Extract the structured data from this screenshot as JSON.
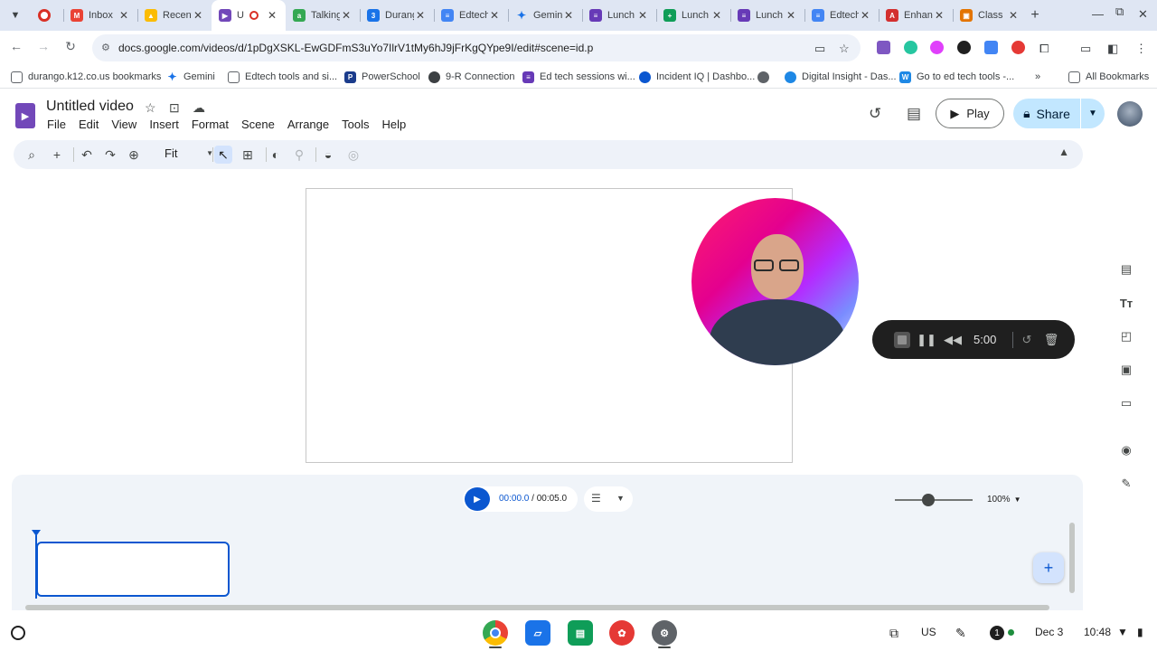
{
  "browser": {
    "tabs": [
      {
        "title": "",
        "color": "#d93025"
      },
      {
        "title": "Inbox",
        "color": "#ea4335"
      },
      {
        "title": "Recent",
        "color": "#fbbc04"
      },
      {
        "title": "U",
        "color": "#7248b9",
        "recording_indicator": true
      },
      {
        "title": "Talking",
        "color": "#34a853"
      },
      {
        "title": "Durango",
        "color": "#1a73e8"
      },
      {
        "title": "Edtech",
        "color": "#4285f4"
      },
      {
        "title": "Gemini",
        "color": "#1a73e8"
      },
      {
        "title": "Lunch",
        "color": "#673ab7"
      },
      {
        "title": "Lunch",
        "color": "#0f9d58"
      },
      {
        "title": "Lunch",
        "color": "#673ab7"
      },
      {
        "title": "Edtech",
        "color": "#4285f4"
      },
      {
        "title": "Enhance",
        "color": "#d32f2f"
      },
      {
        "title": "Class",
        "color": "#e37400"
      }
    ],
    "url": "docs.google.com/videos/d/1pDgXSKL-EwGDFmS3uYo7IlrV1tMy6hJ9jFrKgQYpe9I/edit#scene=id.p",
    "bookmarks": [
      {
        "label": "durango.k12.co.us bookmarks",
        "icon": "folder-icon"
      },
      {
        "label": "Gemini",
        "icon": "gemini-icon"
      },
      {
        "label": "Edtech tools and si...",
        "icon": "folder-icon"
      },
      {
        "label": "PowerSchool",
        "icon": "powerschool-icon"
      },
      {
        "label": "9-R Connection",
        "icon": "connection-icon"
      },
      {
        "label": "Ed tech sessions wi...",
        "icon": "forms-icon"
      },
      {
        "label": "Incident IQ | Dashbo...",
        "icon": "incidentiq-icon"
      },
      {
        "label": "",
        "icon": "globe-icon"
      },
      {
        "label": "Digital Insight - Das...",
        "icon": "insight-icon"
      },
      {
        "label": "Go to ed tech tools -...",
        "icon": "w-icon"
      }
    ],
    "all_bookmarks": "All Bookmarks",
    "more_bookmarks": "»"
  },
  "app": {
    "title": "Untitled video",
    "menu": [
      "File",
      "Edit",
      "View",
      "Insert",
      "Format",
      "Scene",
      "Arrange",
      "Tools",
      "Help"
    ],
    "play_label": "Play",
    "share_label": "Share",
    "zoom_label": "Fit"
  },
  "recorder": {
    "time": "5:00"
  },
  "timeline": {
    "current": "00:00.0",
    "separator": " / ",
    "total": "00:05.0",
    "zoom": "100%"
  },
  "shelf": {
    "locale": "US",
    "notification_count": "1",
    "date": "Dec 3",
    "time": "10:48"
  }
}
